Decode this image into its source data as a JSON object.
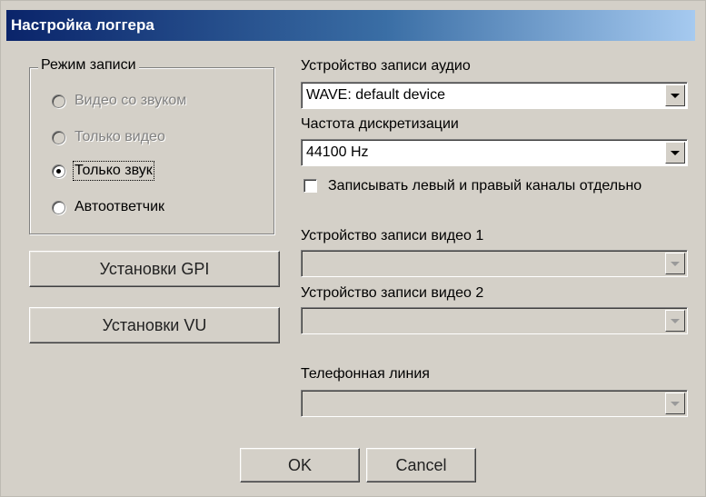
{
  "window": {
    "title": "Настройка логгера"
  },
  "record_mode": {
    "group_label": "Режим записи",
    "options": [
      {
        "label": "Видео со звуком",
        "enabled": false,
        "selected": false
      },
      {
        "label": "Только видео",
        "enabled": false,
        "selected": false
      },
      {
        "label": "Только звук",
        "enabled": true,
        "selected": true
      },
      {
        "label": "Автоответчик",
        "enabled": true,
        "selected": false
      }
    ]
  },
  "buttons": {
    "gpi_settings": "Установки GPI",
    "vu_settings": "Установки VU",
    "ok": "OK",
    "cancel": "Cancel"
  },
  "audio": {
    "device_label": "Устройство записи аудио",
    "device_value": "WAVE: default device",
    "rate_label": "Частота дискретизации",
    "rate_value": "44100 Hz",
    "separate_channels_label": "Записывать левый и правый каналы отдельно",
    "separate_channels_checked": false
  },
  "video": {
    "device1_label": "Устройство записи видео 1",
    "device1_value": "",
    "device2_label": "Устройство записи видео 2",
    "device2_value": ""
  },
  "phone": {
    "line_label": "Телефонная линия",
    "line_value": ""
  }
}
